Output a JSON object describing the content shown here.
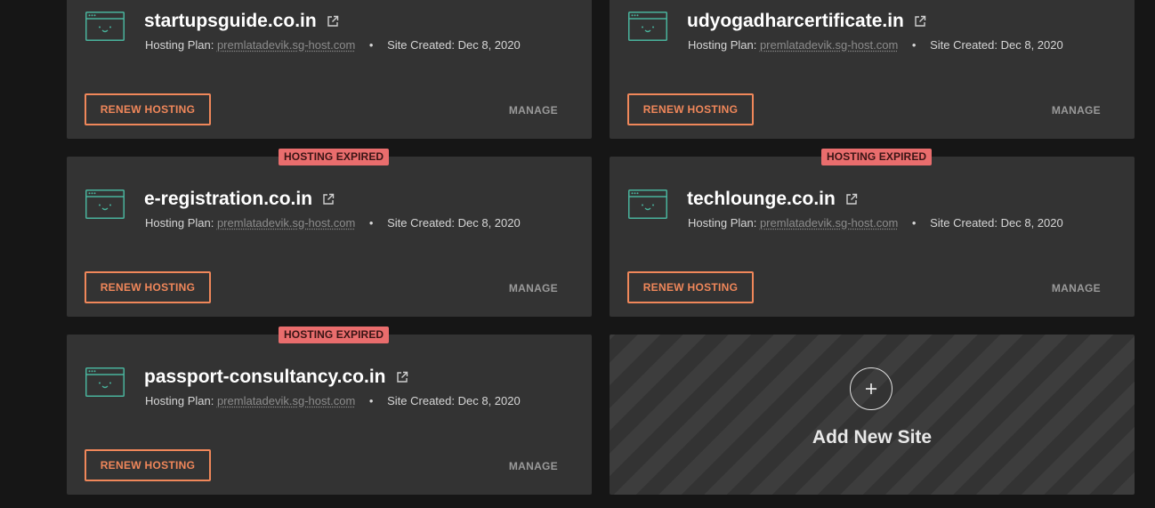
{
  "colors": {
    "background": "#161616",
    "card": "#333333",
    "accent_orange": "#f0875a",
    "badge_red": "#e96d6d",
    "icon_green": "#49b39c"
  },
  "icons": {
    "site": "browser-window-smiley-icon",
    "external": "external-link-icon",
    "add": "plus-icon"
  },
  "sites": [
    {
      "name": "startupsguide.co.in",
      "badge": "",
      "plan_label": "Hosting Plan:",
      "plan_host": "premlatadevik.sg-host.com",
      "separator": "•",
      "created_label": "Site Created:",
      "created_date": "Dec 8, 2020",
      "renew_label": "RENEW HOSTING",
      "manage_label": "MANAGE"
    },
    {
      "name": "udyogadharcertificate.in",
      "badge": "",
      "plan_label": "Hosting Plan:",
      "plan_host": "premlatadevik.sg-host.com",
      "separator": "•",
      "created_label": "Site Created:",
      "created_date": "Dec 8, 2020",
      "renew_label": "RENEW HOSTING",
      "manage_label": "MANAGE"
    },
    {
      "name": "e-registration.co.in",
      "badge": "HOSTING EXPIRED",
      "plan_label": "Hosting Plan:",
      "plan_host": "premlatadevik.sg-host.com",
      "separator": "•",
      "created_label": "Site Created:",
      "created_date": "Dec 8, 2020",
      "renew_label": "RENEW HOSTING",
      "manage_label": "MANAGE"
    },
    {
      "name": "techlounge.co.in",
      "badge": "HOSTING EXPIRED",
      "plan_label": "Hosting Plan:",
      "plan_host": "premlatadevik.sg-host.com",
      "separator": "•",
      "created_label": "Site Created:",
      "created_date": "Dec 8, 2020",
      "renew_label": "RENEW HOSTING",
      "manage_label": "MANAGE"
    },
    {
      "name": "passport-consultancy.co.in",
      "badge": "HOSTING EXPIRED",
      "plan_label": "Hosting Plan:",
      "plan_host": "premlatadevik.sg-host.com",
      "separator": "•",
      "created_label": "Site Created:",
      "created_date": "Dec 8, 2020",
      "renew_label": "RENEW HOSTING",
      "manage_label": "MANAGE"
    }
  ],
  "add_site": {
    "icon_glyph": "+",
    "label": "Add New Site"
  }
}
